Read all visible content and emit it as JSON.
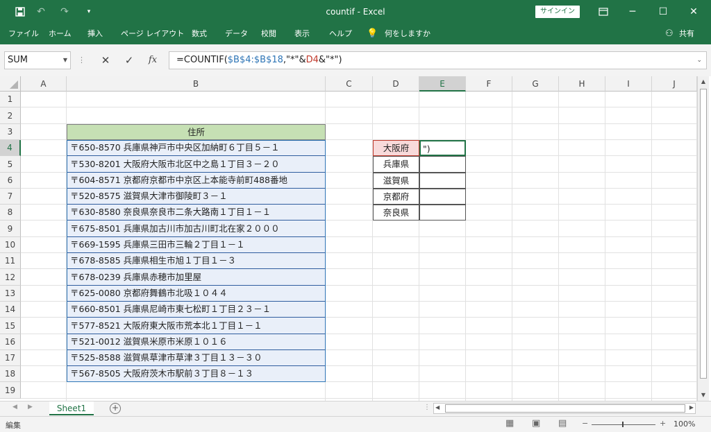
{
  "titlebar": {
    "title": "countif  -  Excel",
    "signin": "サインイン",
    "save_icon": "save-icon",
    "undo_icon": "undo-icon",
    "redo_icon": "redo-icon"
  },
  "ribbon": {
    "tabs": [
      "ファイル",
      "ホーム",
      "挿入",
      "ページ レイアウト",
      "数式",
      "データ",
      "校閲",
      "表示",
      "ヘルプ"
    ],
    "tellme": "何をしますか",
    "share": "共有"
  },
  "formula_bar": {
    "namebox": "SUM",
    "fx": "fx",
    "prefix": "=COUNTIF(",
    "ref1": "$B$4:$B$18",
    "mid": ",\"*\"&",
    "ref2": "D4",
    "suffix": "&\"*\")"
  },
  "columns": [
    "A",
    "B",
    "C",
    "D",
    "E",
    "F",
    "G",
    "H",
    "I",
    "J"
  ],
  "rows": [
    "1",
    "2",
    "3",
    "4",
    "5",
    "6",
    "7",
    "8",
    "9",
    "10",
    "11",
    "12",
    "13",
    "14",
    "15",
    "16",
    "17",
    "18",
    "19"
  ],
  "table": {
    "header": "住所",
    "addresses": [
      "〒650-8570 兵庫県神戸市中央区加納町６丁目５－１",
      "〒530-8201 大阪府大阪市北区中之島１丁目３－２０",
      "〒604-8571 京都府京都市中京区上本能寺前町488番地",
      "〒520-8575 滋賀県大津市御陵町３－１",
      "〒630-8580 奈良県奈良市二条大路南１丁目１－１",
      "〒675-8501 兵庫県加古川市加古川町北在家２０００",
      "〒669-1595 兵庫県三田市三輪２丁目１－１",
      "〒678-8585 兵庫県相生市旭１丁目１－３",
      "〒678-0239 兵庫県赤穂市加里屋",
      "〒625-0080 京都府舞鶴市北吸１０４４",
      "〒660-8501 兵庫県尼崎市東七松町１丁目２３－１",
      "〒577-8521 大阪府東大阪市荒本北１丁目１－１",
      "〒521-0012 滋賀県米原市米原１０１６",
      "〒525-8588 滋賀県草津市草津３丁目１３－３０",
      "〒567-8505 大阪府茨木市駅前３丁目８－１３"
    ]
  },
  "prefectures": [
    "大阪府",
    "兵庫県",
    "滋賀県",
    "京都府",
    "奈良県"
  ],
  "e4_value": "\")",
  "sheet_tab": "Sheet1",
  "status": {
    "mode": "編集",
    "zoom": "100%"
  },
  "colors": {
    "excel_green": "#217346",
    "header_fill": "#c6e0b4",
    "address_fill": "#e9eff9",
    "ref1": "#2e75b6",
    "ref2": "#c0392b"
  }
}
